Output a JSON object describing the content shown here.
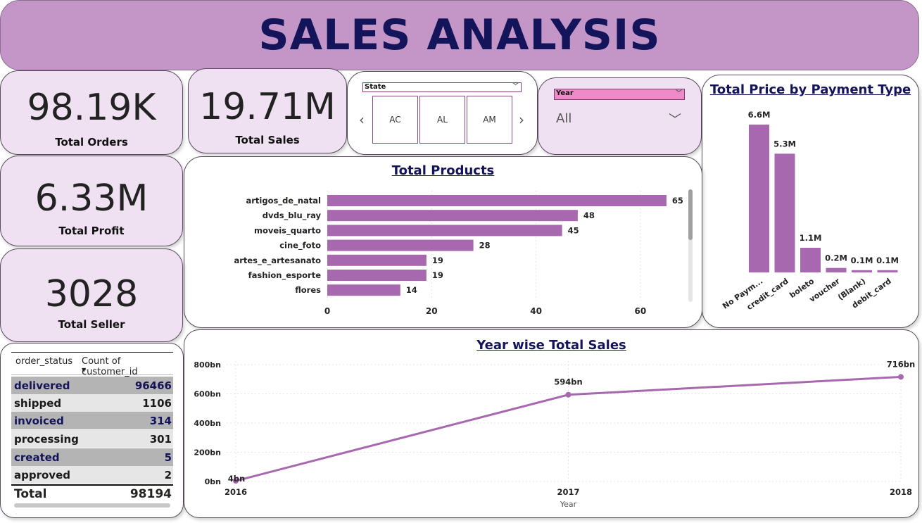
{
  "header": {
    "title": "SALES ANALYSIS"
  },
  "kpis": {
    "orders": {
      "value": "98.19K",
      "label": "Total Orders"
    },
    "sales": {
      "value": "19.71M",
      "label": "Total Sales"
    },
    "profit": {
      "value": "6.33M",
      "label": "Total Profit"
    },
    "seller": {
      "value": "3028",
      "label": "Total Seller"
    }
  },
  "state_slicer": {
    "label": "State",
    "tiles": [
      "AC",
      "AL",
      "AM"
    ]
  },
  "year_slicer": {
    "label": "Year",
    "selected": "All"
  },
  "status_table": {
    "headers": [
      "order_status",
      "Count of customer_id"
    ],
    "rows": [
      {
        "status": "delivered",
        "count": "96466"
      },
      {
        "status": "shipped",
        "count": "1106"
      },
      {
        "status": "invoiced",
        "count": "314"
      },
      {
        "status": "processing",
        "count": "301"
      },
      {
        "status": "created",
        "count": "5"
      },
      {
        "status": "approved",
        "count": "2"
      }
    ],
    "total_label": "Total",
    "total_value": "98194"
  },
  "colors": {
    "bar": "#a868b0",
    "title": "#13145a",
    "panel": "#efe0f2",
    "header": "#c496c8"
  },
  "chart_data": [
    {
      "type": "bar",
      "orientation": "horizontal",
      "title": "Total Products",
      "categories": [
        "artigos_de_natal",
        "dvds_blu_ray",
        "moveis_quarto",
        "cine_foto",
        "artes_e_artesanato",
        "fashion_esporte",
        "flores"
      ],
      "values": [
        65,
        48,
        45,
        28,
        19,
        19,
        14
      ],
      "labels": [
        "65",
        "48",
        "45",
        "28",
        "19",
        "19",
        "14"
      ],
      "xlim": [
        0,
        70
      ],
      "ticks": [
        0,
        20,
        40,
        60
      ],
      "tick_labels": [
        "0",
        "20",
        "40",
        "60"
      ]
    },
    {
      "type": "bar",
      "title": "Total Price by Payment Type",
      "categories": [
        "No Paym...",
        "credit_card",
        "boleto",
        "voucher",
        "(Blank)",
        "debit_card"
      ],
      "values": [
        6.6,
        5.3,
        1.1,
        0.2,
        0.1,
        0.1
      ],
      "labels": [
        "6.6M",
        "5.3M",
        "1.1M",
        "0.2M",
        "0.1M",
        "0.1M"
      ],
      "ylim": [
        0,
        6.6
      ]
    },
    {
      "type": "line",
      "title": "Year wise Total Sales",
      "xlabel": "Year",
      "x": [
        "2016",
        "2017",
        "2018"
      ],
      "values": [
        4,
        594,
        716
      ],
      "labels": [
        "4bn",
        "594bn",
        "716bn"
      ],
      "ylim": [
        0,
        800
      ],
      "yticks": [
        0,
        200,
        400,
        600,
        800
      ],
      "ytick_labels": [
        "0bn",
        "200bn",
        "400bn",
        "600bn",
        "800bn"
      ]
    }
  ]
}
